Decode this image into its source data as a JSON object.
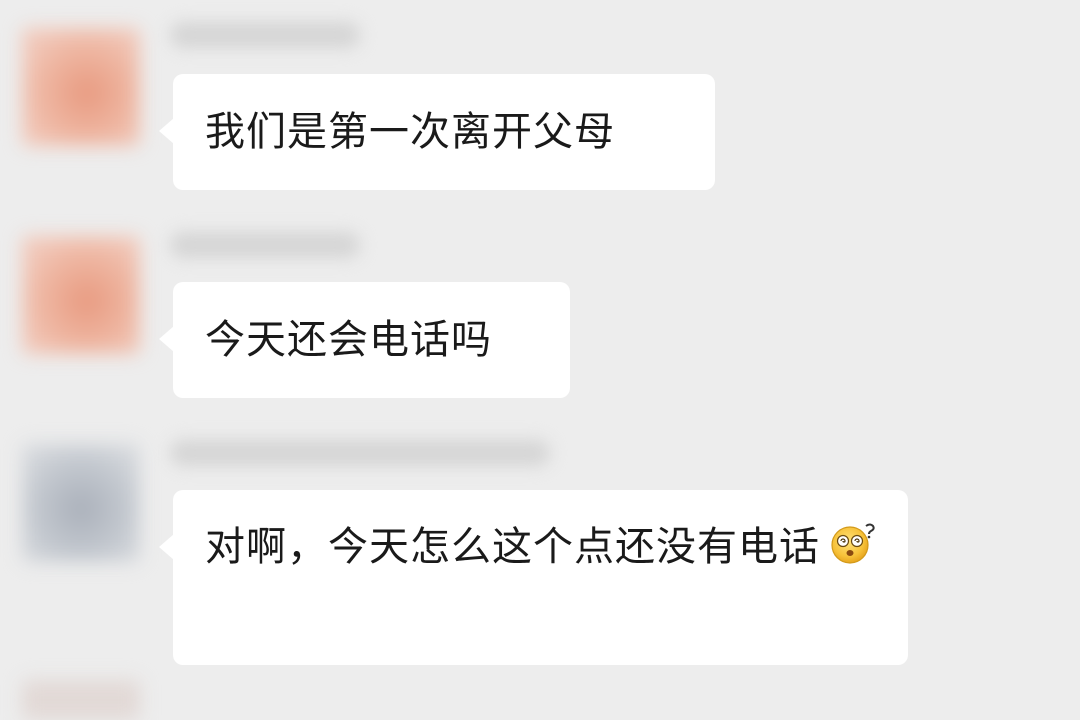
{
  "messages": [
    {
      "text": "我们是第一次离开父母"
    },
    {
      "text": "今天还会电话吗"
    },
    {
      "text": "对啊，今天怎么这个点还没有电话",
      "emoji": "dizzy-face-emoji"
    }
  ],
  "colors": {
    "background": "#ededed",
    "bubble": "#ffffff",
    "text": "#1a1a1a"
  }
}
